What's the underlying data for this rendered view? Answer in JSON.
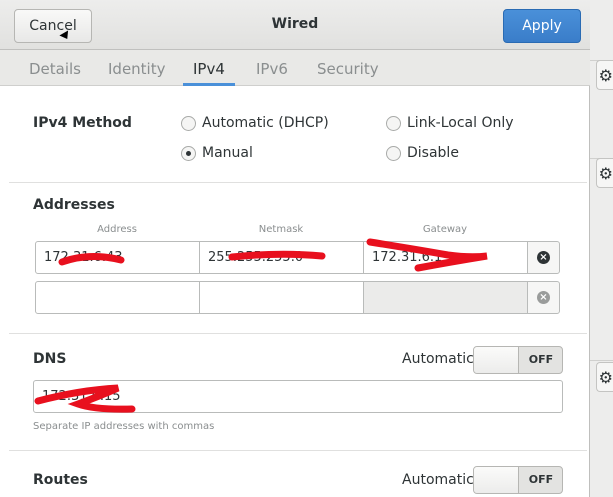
{
  "dialog": {
    "title": "Wired",
    "cancel_label": "Cancel",
    "apply_label": "Apply"
  },
  "tabs": [
    {
      "label": "Details"
    },
    {
      "label": "Identity"
    },
    {
      "label": "IPv4"
    },
    {
      "label": "IPv6"
    },
    {
      "label": "Security"
    }
  ],
  "active_tab": "IPv4",
  "ipv4_method": {
    "label": "IPv4 Method",
    "options": [
      {
        "label": "Automatic (DHCP)",
        "checked": false
      },
      {
        "label": "Link-Local Only",
        "checked": false
      },
      {
        "label": "Manual",
        "checked": true
      },
      {
        "label": "Disable",
        "checked": false
      }
    ]
  },
  "addresses": {
    "label": "Addresses",
    "columns": [
      "Address",
      "Netmask",
      "Gateway"
    ],
    "rows": [
      {
        "address": "172.31.6.43",
        "netmask": "255.255.255.0",
        "gateway": "172.31.6.1"
      },
      {
        "address": "",
        "netmask": "",
        "gateway": ""
      }
    ]
  },
  "dns": {
    "label": "DNS",
    "automatic_label": "Automatic",
    "switch_state": "OFF",
    "value": "172.31.6.15",
    "hint": "Separate IP addresses with commas"
  },
  "routes": {
    "label": "Routes",
    "automatic_label": "Automatic",
    "switch_state": "OFF"
  },
  "icons": {
    "delete_row": "close-circle-icon",
    "background_settings": "gear-icon"
  },
  "colors": {
    "accent": "#4a90d9",
    "redaction": "#e8101e"
  }
}
